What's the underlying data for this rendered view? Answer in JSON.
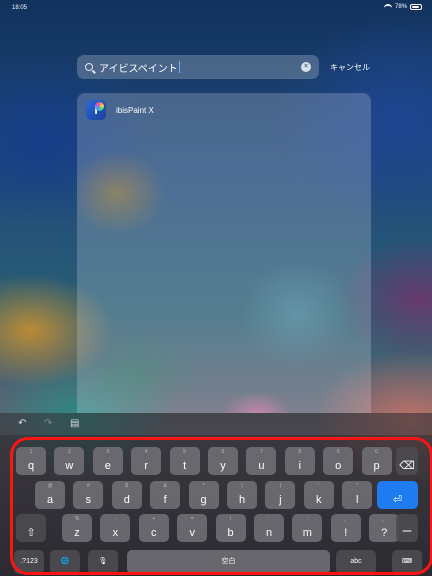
{
  "status": {
    "time": "18:05",
    "battery": "78%"
  },
  "search": {
    "query": "アイビスペイント",
    "cancel": "キャンセル"
  },
  "result": {
    "app_name": "ibisPaint X"
  },
  "keyboard": {
    "row1": [
      {
        "hint": "1",
        "key": "q"
      },
      {
        "hint": "2",
        "key": "w"
      },
      {
        "hint": "3",
        "key": "e"
      },
      {
        "hint": "4",
        "key": "r"
      },
      {
        "hint": "5",
        "key": "t"
      },
      {
        "hint": "6",
        "key": "y"
      },
      {
        "hint": "7",
        "key": "u"
      },
      {
        "hint": "8",
        "key": "i"
      },
      {
        "hint": "9",
        "key": "o"
      },
      {
        "hint": "0",
        "key": "p"
      }
    ],
    "row2": [
      {
        "hint": "@",
        "key": "a"
      },
      {
        "hint": "#",
        "key": "s"
      },
      {
        "hint": "$",
        "key": "d"
      },
      {
        "hint": "&",
        "key": "f"
      },
      {
        "hint": "*",
        "key": "g"
      },
      {
        "hint": "(",
        "key": "h"
      },
      {
        "hint": ")",
        "key": "j"
      },
      {
        "hint": "'",
        "key": "k"
      },
      {
        "hint": "\"",
        "key": "l"
      }
    ],
    "row3": [
      {
        "hint": "%",
        "key": "z"
      },
      {
        "hint": "-",
        "key": "x"
      },
      {
        "hint": "+",
        "key": "c"
      },
      {
        "hint": "=",
        "key": "v"
      },
      {
        "hint": "/",
        "key": "b"
      },
      {
        "hint": ";",
        "key": "n"
      },
      {
        "hint": ":",
        "key": "m"
      },
      {
        "hint": "、",
        "key": "!"
      },
      {
        "hint": "。",
        "key": "?"
      }
    ],
    "numbers_label": ".?123",
    "space_label": "空白",
    "abc_label": "abc",
    "dash_label": "ー"
  }
}
